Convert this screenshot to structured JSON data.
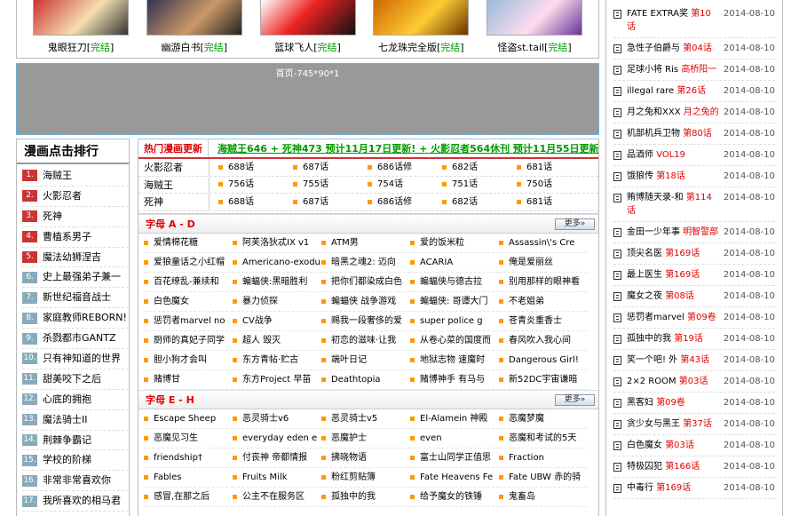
{
  "top_covers": [
    {
      "title": "鬼眼狂刀",
      "status": "完结"
    },
    {
      "title": "幽游白书",
      "status": "完结"
    },
    {
      "title": "篮球飞人",
      "status": "完结"
    },
    {
      "title": "七龙珠完全版",
      "status": "完结"
    },
    {
      "title": "怪盗st.tail",
      "status": "完结"
    }
  ],
  "ad_label": "首页-745*90*1",
  "rank": {
    "title": "漫画点击排行",
    "items": [
      "海贼王",
      "火影忍者",
      "死神",
      "曹植系男子",
      "魔法幼狮涅吉",
      "史上最强弟子兼一",
      "新世纪福音战士",
      "家庭教师REBORN!",
      "杀戮都市GANTZ",
      "只有神知道的世界",
      "甜美咬下之后",
      "心底的拥抱",
      "魔法骑士II",
      "荆棘争霸记",
      "学校的阶梯",
      "非常非常喜欢你",
      "我所喜欢的相马君"
    ]
  },
  "hot": {
    "label": "热门漫画更新",
    "news": "海贼王646 + 死神473 预计11月17日更新! + 火影忍者564休刊 预计11月55日更新",
    "rows": [
      {
        "title": "火影忍者",
        "eps": [
          "688话",
          "687话",
          "686话修",
          "682话",
          "681话"
        ]
      },
      {
        "title": "海贼王",
        "eps": [
          "756话",
          "755话",
          "754话",
          "751话",
          "750话"
        ]
      },
      {
        "title": "死神",
        "eps": [
          "688话",
          "687话",
          "686话修",
          "682话",
          "681话"
        ]
      }
    ]
  },
  "sections": [
    {
      "title": "字母 A - D",
      "more": "更多»",
      "items": [
        "爱情棉花糖",
        "阿芙洛狄忒IX v1",
        "ATM男",
        "爱的饭米粒",
        "Assassin\\'s Cre",
        "爱狼童话之小红帽",
        "Americano-exodu",
        "暗黑之魂2: 迈向",
        "ACARIA",
        "俺是爱丽丝",
        "百花缭乱-兼续和",
        "蝙蝠侠:黑暗胜利",
        "把你们都染成白色",
        "蝙蝠侠与德古拉",
        "别用那样的眼神看",
        "白色魔女",
        "暴力侦探",
        "蝙蝠侠 战争游戏",
        "蝙蝠侠: 哥谭大门",
        "不老姐弟",
        "惩罚者marvel no",
        "CV战争",
        "赐我一段奢侈的爱",
        "super police g",
        "苍青炎重香士",
        "厨师的真妃子同学",
        "超人 毁灭",
        "初恋的滋味·让我",
        "从卷心菜的国度而",
        "春风吹入我心间",
        "胆小狗才会叫",
        "东方青帖·贮古",
        "端叶日记",
        "地狱志物 速魔时",
        "Dangerous Girl!",
        "赌博甘",
        "东方Project 早苗",
        "Deathtopia",
        "赌博神手 有马与",
        "新52DC宇宙谦暗"
      ]
    },
    {
      "title": "字母 E - H",
      "more": "更多»",
      "items": [
        "Escape Sheep",
        "恶灵骑士v6",
        "恶灵骑士v5",
        "El-Alamein 神殿",
        "恶魔梦魔",
        "恶魔见习生",
        "everyday eden e",
        "恶魔护士",
        "even",
        "恶魔和考试的5天",
        "friendship†",
        "付丧神 帝都情报",
        "拂晓物语",
        "富士山同学正值思",
        "Fraction",
        "Fables",
        "Fruits Milk",
        "粉红剪贴簿",
        "Fate Heavens Fe",
        "Fate UBW 赤的骑",
        "感冒,在那之后",
        "公主不在服务区",
        "孤独中的我",
        "给予魔女的铁锤",
        "鬼畜岛"
      ]
    }
  ],
  "side": [
    {
      "title": "FATE EXTRA奖",
      "ep": "第10话",
      "date": "2014-08-10"
    },
    {
      "title": "急性子伯爵与",
      "ep": "第04话",
      "date": "2014-08-10"
    },
    {
      "title": "足球小将 Ris",
      "ep": "高桥阳一",
      "date": "2014-08-10"
    },
    {
      "title": "illegal rare",
      "ep": "第26话",
      "date": "2014-08-10"
    },
    {
      "title": "月之兔和XXX",
      "ep": "月之兔的",
      "date": "2014-08-10"
    },
    {
      "title": "机部机兵卫物",
      "ep": "第80话",
      "date": "2014-08-10"
    },
    {
      "title": "品酒师",
      "ep": "VOL19",
      "date": "2014-08-10"
    },
    {
      "title": "饿狼传",
      "ep": "第18话",
      "date": "2014-08-10"
    },
    {
      "title": "贿博随天录-和",
      "ep": "第114话",
      "date": "2014-08-10"
    },
    {
      "title": "金田一少年事",
      "ep": "明智警部",
      "date": "2014-08-10"
    },
    {
      "title": "顶尖名医",
      "ep": "第169话",
      "date": "2014-08-10"
    },
    {
      "title": "最上医生",
      "ep": "第169话",
      "date": "2014-08-10"
    },
    {
      "title": "魔女之夜",
      "ep": "第08话",
      "date": "2014-08-10"
    },
    {
      "title": "惩罚者marvel",
      "ep": "第09卷",
      "date": "2014-08-10"
    },
    {
      "title": "孤独中的我",
      "ep": "第19话",
      "date": "2014-08-10"
    },
    {
      "title": "笑一个吧! 外",
      "ep": "第43话",
      "date": "2014-08-10"
    },
    {
      "title": "2×2 ROOM",
      "ep": "第03话",
      "date": "2014-08-10"
    },
    {
      "title": "黑客妇",
      "ep": "第09卷",
      "date": "2014-08-10"
    },
    {
      "title": "贪少女与黑王",
      "ep": "第37话",
      "date": "2014-08-10"
    },
    {
      "title": "白色魔女",
      "ep": "第03话",
      "date": "2014-08-10"
    },
    {
      "title": "特极囚犯",
      "ep": "第166话",
      "date": "2014-08-10"
    },
    {
      "title": "中毒行",
      "ep": "第169话",
      "date": "2014-08-10"
    }
  ]
}
